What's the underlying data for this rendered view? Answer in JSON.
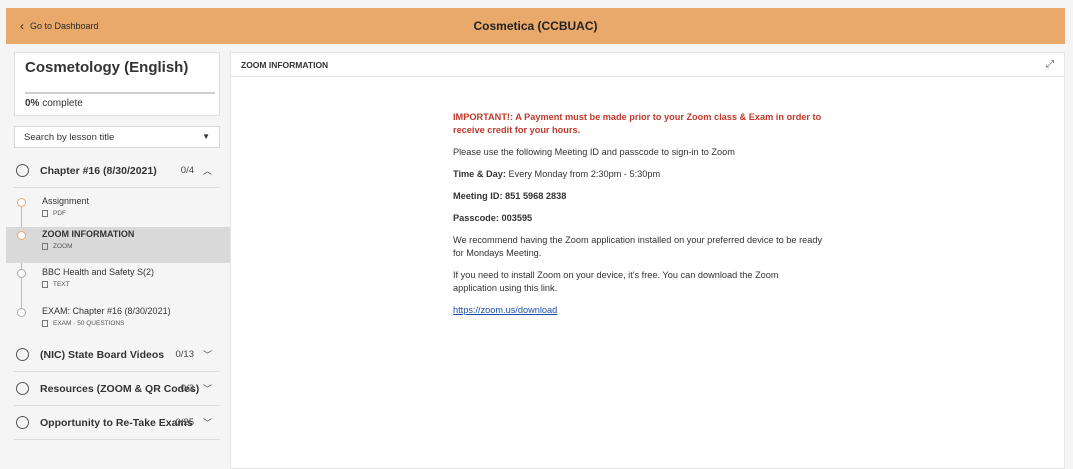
{
  "header": {
    "back_label": "Go to Dashboard",
    "course_title": "Cosmetica (CCBUAC)"
  },
  "sidebar": {
    "course_name": "Cosmetology (English)",
    "progress_percent": "0%",
    "progress_suffix": "complete",
    "search_placeholder": "Search by lesson title",
    "chapters": [
      {
        "title": "Chapter #16 (8/30/2021)",
        "count": "0/4",
        "expanded": true
      },
      {
        "title": "(NIC) State Board Videos",
        "count": "0/13",
        "expanded": false
      },
      {
        "title": "Resources (ZOOM & QR Codes)",
        "count": "0/2",
        "expanded": false
      },
      {
        "title": "Opportunity to Re-Take Exams",
        "count": "0/25",
        "expanded": false
      }
    ],
    "lessons": [
      {
        "title": "Assignment",
        "type": "PDF"
      },
      {
        "title": "ZOOM INFORMATION",
        "type": "ZOOM"
      },
      {
        "title": "BBC Health and Safety S(2)",
        "type": "TEXT"
      },
      {
        "title": "EXAM: Chapter #16 (8/30/2021)",
        "type": "EXAM · 50 QUESTIONS"
      }
    ]
  },
  "main": {
    "section_title": "ZOOM INFORMATION",
    "important": "IMPORTANT!: A Payment must be made prior to your Zoom class & Exam in order to receive credit for your hours.",
    "instructions": "Please use the following Meeting ID and passcode to sign-in to Zoom",
    "time_label": "Time & Day:",
    "time_value": "Every Monday from 2:30pm - 5:30pm",
    "meeting_id": "Meeting ID: 851 5968 2838",
    "passcode": "Passcode: 003595",
    "recommend": "We recommend having the Zoom application installed on your preferred device to be ready for Mondays Meeting.",
    "install": "If you need to install Zoom on your device, it's free. You can download the Zoom application using this link.",
    "link": "https://zoom.us/download"
  }
}
